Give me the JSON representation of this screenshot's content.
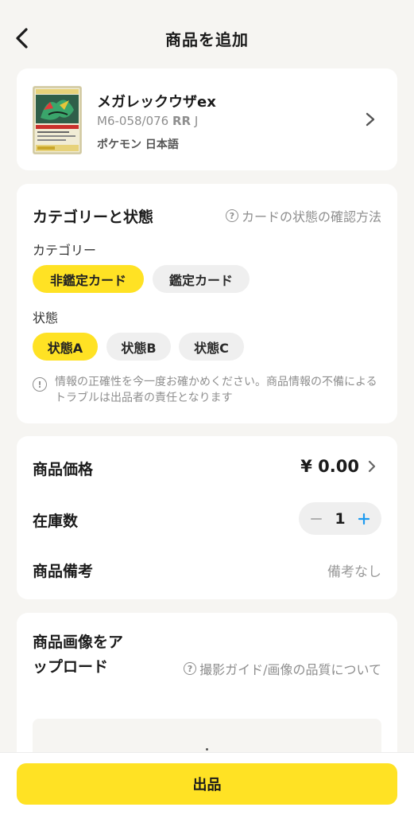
{
  "header": {
    "title": "商品を追加"
  },
  "product": {
    "name": "メガレックウザex",
    "code": "M6-058/076",
    "rarity": "RR",
    "lang_code": "J",
    "game": "ポケモン 日本語"
  },
  "category_section": {
    "title": "カテゴリーと状態",
    "help_link": "カードの状態の確認方法",
    "category_label": "カテゴリー",
    "categories": [
      "非鑑定カード",
      "鑑定カード"
    ],
    "selected_category": "非鑑定カード",
    "condition_label": "状態",
    "conditions": [
      "状態A",
      "状態B",
      "状態C"
    ],
    "selected_condition": "状態A",
    "notice": "情報の正確性を今一度お確かめください。商品情報の不備によるトラブルは出品者の責任となります"
  },
  "details": {
    "price_label": "商品価格",
    "price_value": "¥ 0.00",
    "stock_label": "在庫数",
    "stock_value": "1",
    "memo_label": "商品備考",
    "memo_value": "備考なし"
  },
  "upload": {
    "title": "商品画像をアップロード",
    "guide_link": "撮影ガイド/画像の品質について"
  },
  "footer": {
    "submit_label": "出品"
  },
  "colors": {
    "accent": "#ffe224",
    "background": "#f6f5f2",
    "stepper_plus": "#1e9bf0"
  }
}
